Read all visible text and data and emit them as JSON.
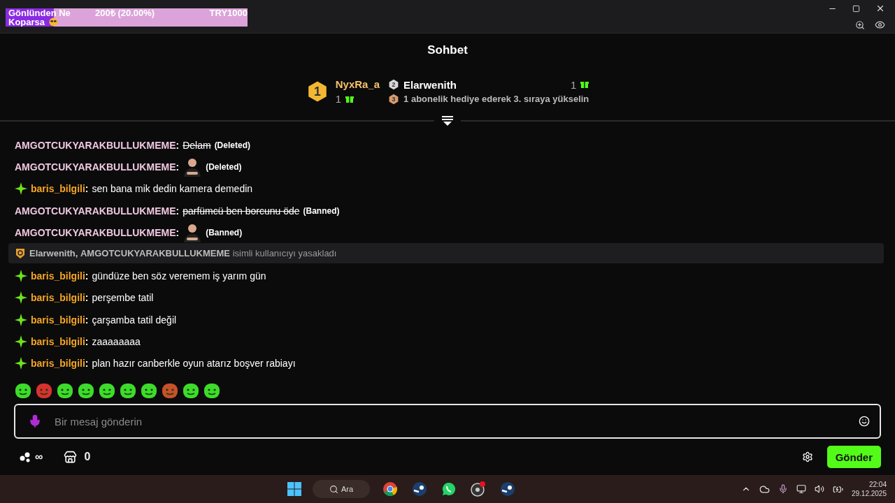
{
  "banner": {
    "line1": "Gönlünden Ne",
    "amount": "200₺ (20.00%)",
    "goal": "TRY1000",
    "line2": "Koparsa",
    "level": 0.2
  },
  "chat": {
    "title": "Sohbet",
    "leaderboard": {
      "first": {
        "rank": "1",
        "name": "NyxRa_a",
        "count": "1"
      },
      "second": {
        "rank": "2",
        "name": "Elarwenith",
        "count": "1"
      },
      "hint": {
        "rank": "3",
        "text": "1 abonelik hediye ederek 3. sıraya yükselin"
      }
    },
    "messages": [
      {
        "kind": "text",
        "user": "AMGOTCUKYARAKBULLUKMEME",
        "color": "#f0c8e0",
        "badge": false,
        "text": "Delam",
        "struck": true,
        "note": "(Deleted)"
      },
      {
        "kind": "emote",
        "user": "AMGOTCUKYARAKBULLUKMEME",
        "color": "#f0c8e0",
        "badge": false,
        "note": "(Deleted)"
      },
      {
        "kind": "text",
        "user": "baris_bilgili",
        "color": "#f5a623",
        "badge": true,
        "text": "sen bana mik dedin kamera demedin",
        "struck": false
      },
      {
        "kind": "text",
        "user": "AMGOTCUKYARAKBULLUKMEME",
        "color": "#f0c8e0",
        "badge": false,
        "text": "parfümcü ben borcunu öde",
        "struck": true,
        "note": "(Banned)"
      },
      {
        "kind": "emote",
        "user": "AMGOTCUKYARAKBULLUKMEME",
        "color": "#f0c8e0",
        "badge": false,
        "note": "(Banned)"
      },
      {
        "kind": "mod",
        "actor": "Elarwenith,",
        "target": "AMGOTCUKYARAKBULLUKMEME",
        "text": "isimli kullanıcıyı yasakladı"
      },
      {
        "kind": "text",
        "user": "baris_bilgili",
        "color": "#f5a623",
        "badge": true,
        "text": "gündüze ben söz veremem iş yarım gün",
        "struck": false
      },
      {
        "kind": "text",
        "user": "baris_bilgili",
        "color": "#f5a623",
        "badge": true,
        "text": "perşembe tatil",
        "struck": false
      },
      {
        "kind": "text",
        "user": "baris_bilgili",
        "color": "#f5a623",
        "badge": true,
        "text": "çarşamba tatil değil",
        "struck": false
      },
      {
        "kind": "text",
        "user": "baris_bilgili",
        "color": "#f5a623",
        "badge": true,
        "text": "zaaaaaaaa",
        "struck": false
      },
      {
        "kind": "text",
        "user": "baris_bilgili",
        "color": "#f5a623",
        "badge": true,
        "text": "plan hazır canberkle oyun atarız boşver rabiayı",
        "struck": false
      }
    ],
    "emotes": [
      {
        "color": "#3ddc2a"
      },
      {
        "color": "#d93030"
      },
      {
        "color": "#3ddc2a"
      },
      {
        "color": "#3ddc2a"
      },
      {
        "color": "#3ddc2a"
      },
      {
        "color": "#3ddc2a"
      },
      {
        "color": "#3ddc2a"
      },
      {
        "color": "#c8502a"
      },
      {
        "color": "#3ddc2a"
      },
      {
        "color": "#3ddc2a"
      }
    ],
    "separator": ":",
    "input": {
      "placeholder": "Bir mesaj gönderin"
    },
    "points": "∞",
    "store_count": "0",
    "send": "Gönder"
  },
  "taskbar": {
    "search": "Ara",
    "time": "22:04",
    "date": "29.12.2025"
  }
}
